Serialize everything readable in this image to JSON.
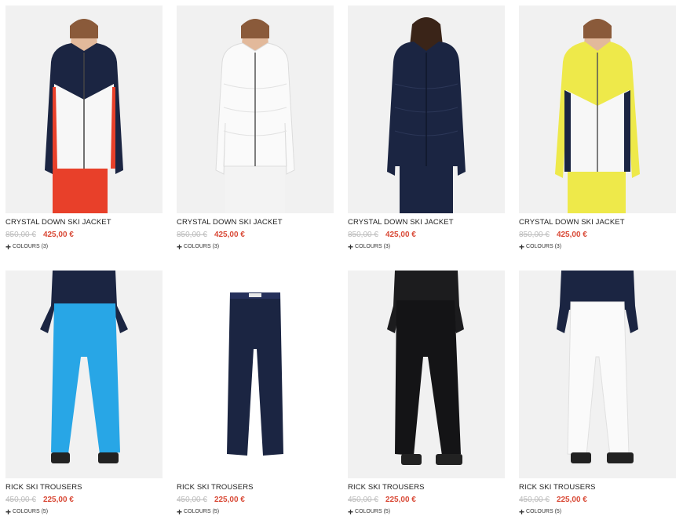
{
  "products": [
    {
      "name": "CRYSTAL DOWN SKI JACKET",
      "old_price": "850,00 €",
      "new_price": "425,00 €",
      "colours": "COLOURS (3)",
      "image": "jacket-red-navy-white"
    },
    {
      "name": "CRYSTAL DOWN SKI JACKET",
      "old_price": "850,00 €",
      "new_price": "425,00 €",
      "colours": "COLOURS (3)",
      "image": "jacket-white"
    },
    {
      "name": "CRYSTAL DOWN SKI JACKET",
      "old_price": "850,00 €",
      "new_price": "425,00 €",
      "colours": "COLOURS (3)",
      "image": "jacket-navy"
    },
    {
      "name": "CRYSTAL DOWN SKI JACKET",
      "old_price": "850,00 €",
      "new_price": "425,00 €",
      "colours": "COLOURS (3)",
      "image": "jacket-yellow-white-navy"
    },
    {
      "name": "RICK SKI TROUSERS",
      "old_price": "450,00 €",
      "new_price": "225,00 €",
      "colours": "COLOURS (5)",
      "image": "trousers-blue"
    },
    {
      "name": "RICK SKI TROUSERS",
      "old_price": "450,00 €",
      "new_price": "225,00 €",
      "colours": "COLOURS (5)",
      "image": "trousers-navy-flat"
    },
    {
      "name": "RICK SKI TROUSERS",
      "old_price": "450,00 €",
      "new_price": "225,00 €",
      "colours": "COLOURS (5)",
      "image": "trousers-black"
    },
    {
      "name": "RICK SKI TROUSERS",
      "old_price": "450,00 €",
      "new_price": "225,00 €",
      "colours": "COLOURS (5)",
      "image": "trousers-white"
    }
  ],
  "colors": {
    "navy": "#1b2542",
    "red": "#e8402a",
    "white": "#f7f7f7",
    "yellow": "#eee94a",
    "blue": "#28a6e6",
    "black": "#1c1c1e",
    "sale_price": "#d94a37",
    "old_price": "#bbbbbb",
    "image_bg": "#f1f1f1"
  }
}
